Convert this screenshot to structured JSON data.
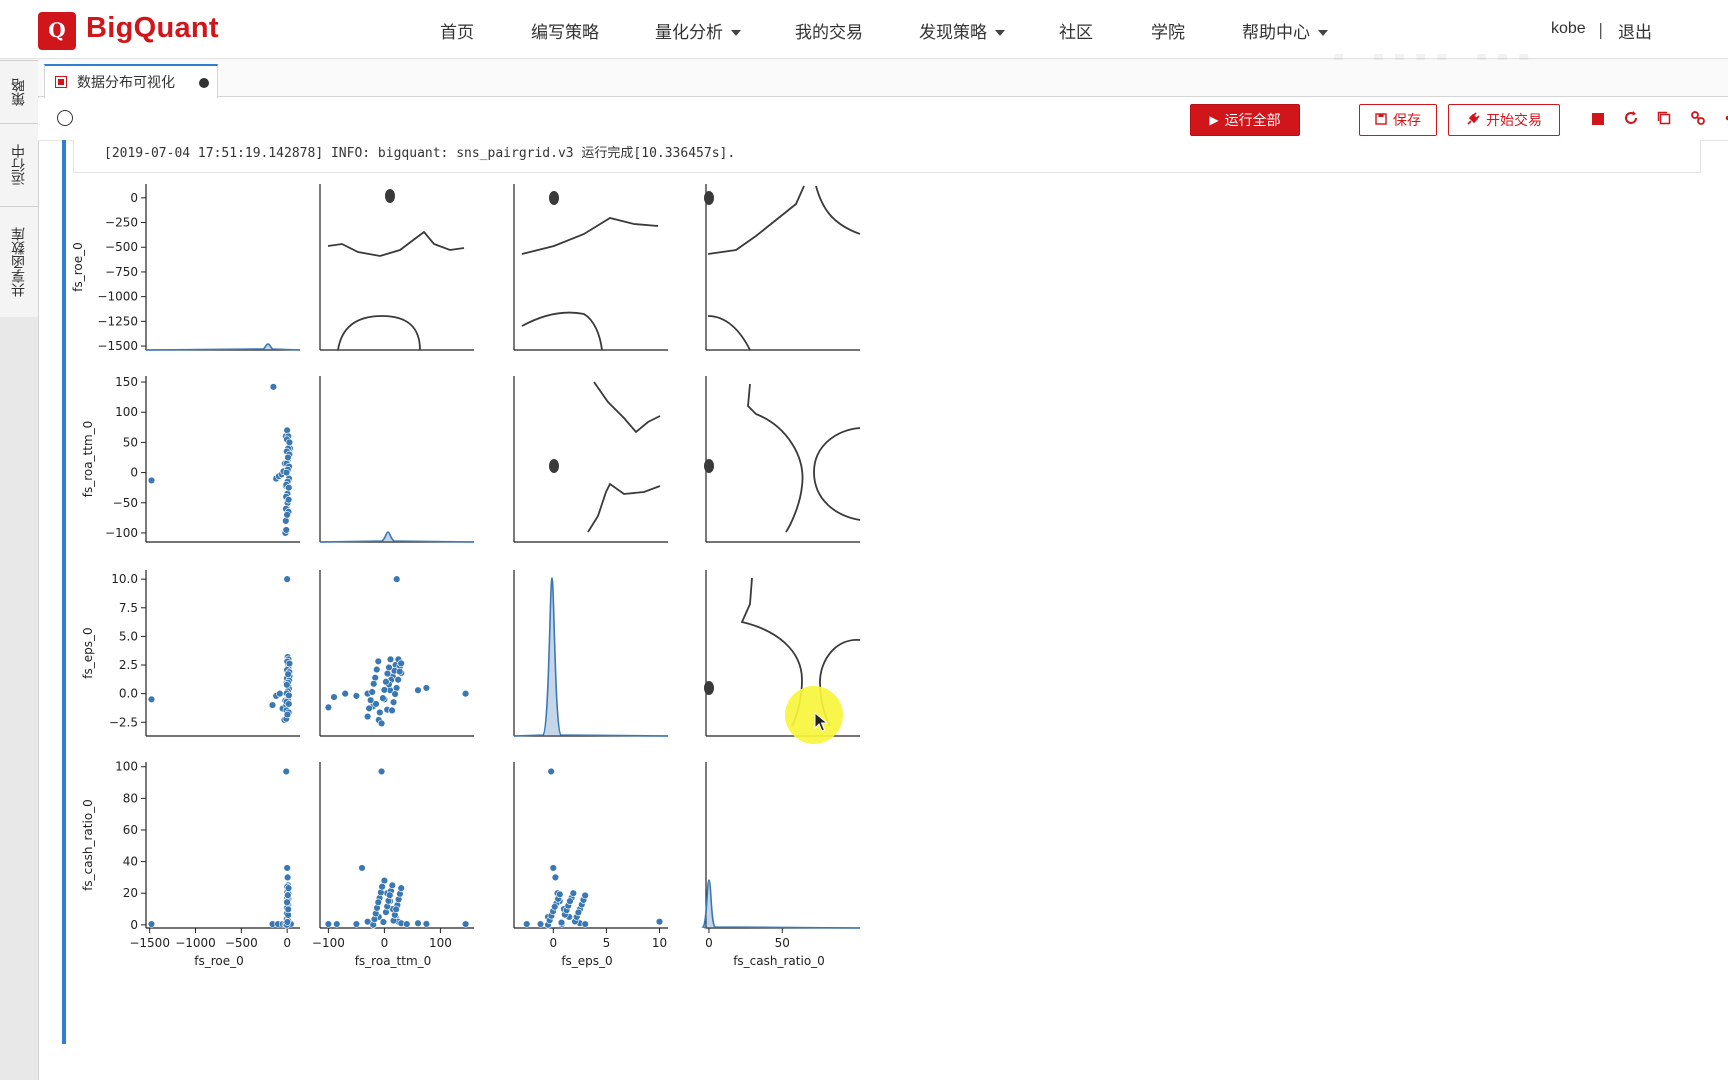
{
  "header": {
    "logo_mark": "Q",
    "logo_text": "BigQuant",
    "nav": [
      {
        "label": "首页",
        "dropdown": false
      },
      {
        "label": "编写策略",
        "dropdown": false
      },
      {
        "label": "量化分析",
        "dropdown": true
      },
      {
        "label": "我的交易",
        "dropdown": false
      },
      {
        "label": "发现策略",
        "dropdown": true
      },
      {
        "label": "社区",
        "dropdown": false
      },
      {
        "label": "学院",
        "dropdown": false
      },
      {
        "label": "帮助中心",
        "dropdown": true
      }
    ],
    "user": "kobe",
    "separator": "|",
    "logout": "退出",
    "brand_color": "#d0161b"
  },
  "sidebar": {
    "tabs": [
      "策略",
      "运行中",
      "共享函数库"
    ]
  },
  "tab": {
    "title": "数据分布可视化",
    "icon": "notebook-file-icon",
    "unsaved_indicator": "dot-icon"
  },
  "toolbar": {
    "run_all": "运行全部",
    "save": "保存",
    "start_trade": "开始交易",
    "icons": [
      "stop-icon",
      "restart-icon",
      "copy-icon",
      "link-icon",
      "share-icon"
    ]
  },
  "cell": {
    "log": "[2019-07-04 17:51:19.142878] INFO: bigquant: sns_pairgrid.v3 运行完成[10.336457s]."
  },
  "watermark": "bilibili",
  "chart_data": {
    "type": "scatter",
    "variables": [
      "fs_roe_0",
      "fs_roa_ttm_0",
      "fs_eps_0",
      "fs_cash_ratio_0"
    ],
    "diagonal": "kde",
    "upper": "kde-contour",
    "lower": "scatter",
    "point_color": "#3a78b4",
    "y_ticks": [
      [
        0,
        -250,
        -500,
        -750,
        -1000,
        -1250,
        -1500
      ],
      [
        150,
        100,
        50,
        0,
        -50,
        -100
      ],
      [
        10.0,
        7.5,
        5.0,
        2.5,
        0.0,
        -2.5
      ],
      [
        100,
        80,
        60,
        40,
        20,
        0
      ]
    ],
    "x_ticks": [
      [
        -1500,
        -1000,
        -500,
        0
      ],
      [
        -100,
        0,
        100
      ],
      [
        0,
        5,
        10
      ],
      [
        0,
        50
      ]
    ],
    "x_tick_labels": [
      [
        "−1500",
        "−1000",
        "−500",
        "0"
      ],
      [
        "−100",
        "0",
        "100"
      ],
      [
        "0",
        "5",
        "10"
      ],
      [
        "0",
        "50"
      ]
    ],
    "y_tick_labels": [
      [
        "0",
        "−250",
        "−500",
        "−750",
        "−1000",
        "−1250",
        "−1500"
      ],
      [
        "150",
        "100",
        "50",
        "0",
        "−50",
        "−100"
      ],
      [
        "10.0",
        "7.5",
        "5.0",
        "2.5",
        "0.0",
        "−2.5"
      ],
      [
        "100",
        "80",
        "60",
        "40",
        "20",
        "0"
      ]
    ],
    "limits": [
      [
        -1540,
        140
      ],
      [
        -115,
        160
      ],
      [
        -3.7,
        10.8
      ],
      [
        -2,
        103
      ]
    ],
    "sample_points": {
      "roe_roa": [
        [
          -1480,
          -13
        ],
        [
          -150,
          142
        ],
        [
          -120,
          -10
        ],
        [
          -90,
          -6
        ],
        [
          -60,
          -3
        ],
        [
          -40,
          2
        ],
        [
          -20,
          -100
        ],
        [
          -15,
          60
        ],
        [
          0,
          70
        ],
        [
          10,
          22
        ],
        [
          20,
          35
        ],
        [
          30,
          40
        ],
        [
          -10,
          -95
        ],
        [
          0,
          -60
        ],
        [
          5,
          -50
        ],
        [
          -5,
          -40
        ],
        [
          10,
          10
        ],
        [
          -25,
          15
        ],
        [
          -15,
          -22
        ]
      ],
      "roe_eps": [
        [
          -1480,
          -0.5
        ],
        [
          -160,
          -1.0
        ],
        [
          -120,
          -0.2
        ],
        [
          -80,
          0.0
        ],
        [
          -50,
          -1.3
        ],
        [
          -30,
          -2.3
        ],
        [
          -10,
          -1.0
        ],
        [
          0,
          10.0
        ],
        [
          5,
          3.2
        ],
        [
          10,
          2.5
        ],
        [
          20,
          2.0
        ],
        [
          -20,
          -0.6
        ],
        [
          -5,
          1.0
        ],
        [
          15,
          0.6
        ],
        [
          25,
          1.5
        ]
      ],
      "roe_cash": [
        [
          -1480,
          0.5
        ],
        [
          -160,
          0.5
        ],
        [
          -100,
          0.5
        ],
        [
          -50,
          0.5
        ],
        [
          -10,
          97
        ],
        [
          0,
          36
        ],
        [
          5,
          30
        ],
        [
          10,
          20
        ],
        [
          0,
          10
        ],
        [
          5,
          5
        ],
        [
          20,
          1
        ],
        [
          30,
          1
        ],
        [
          40,
          0.6
        ],
        [
          -20,
          0.5
        ]
      ],
      "roa_eps": [
        [
          -100,
          -1.2
        ],
        [
          -90,
          -0.3
        ],
        [
          -70,
          0.0
        ],
        [
          -50,
          -0.2
        ],
        [
          -30,
          0.0
        ],
        [
          -20,
          -1.1
        ],
        [
          -10,
          -2.3
        ],
        [
          -5,
          -2.6
        ],
        [
          0,
          -0.5
        ],
        [
          5,
          -1.4
        ],
        [
          10,
          0.3
        ],
        [
          15,
          1.5
        ],
        [
          20,
          2.5
        ],
        [
          25,
          3.0
        ],
        [
          18,
          2.0
        ],
        [
          12,
          1.2
        ],
        [
          8,
          0.8
        ],
        [
          22,
          10.0
        ],
        [
          60,
          0.3
        ],
        [
          75,
          0.5
        ],
        [
          145,
          0.0
        ],
        [
          28,
          2.4
        ],
        [
          -15,
          -0.9
        ],
        [
          30,
          1.8
        ]
      ],
      "roa_cash": [
        [
          -100,
          0.5
        ],
        [
          -85,
          0.5
        ],
        [
          -50,
          0.5
        ],
        [
          -40,
          36
        ],
        [
          -20,
          0.5
        ],
        [
          -5,
          97
        ],
        [
          0,
          28
        ],
        [
          5,
          20
        ],
        [
          10,
          15
        ],
        [
          15,
          10
        ],
        [
          20,
          5
        ],
        [
          25,
          2
        ],
        [
          30,
          1
        ],
        [
          40,
          0.5
        ],
        [
          60,
          1
        ],
        [
          75,
          0.6
        ],
        [
          145,
          0.5
        ],
        [
          -10,
          5
        ],
        [
          -30,
          2
        ]
      ],
      "eps_cash": [
        [
          -2.5,
          0.5
        ],
        [
          -1.2,
          0.5
        ],
        [
          -0.2,
          97
        ],
        [
          0,
          36
        ],
        [
          0.2,
          30
        ],
        [
          0.4,
          20
        ],
        [
          0.6,
          15
        ],
        [
          1.0,
          10
        ],
        [
          1.5,
          5
        ],
        [
          2.0,
          2
        ],
        [
          2.5,
          1
        ],
        [
          3.0,
          0.5
        ],
        [
          10.0,
          2.0
        ],
        [
          -0.5,
          5
        ],
        [
          0.8,
          0.5
        ]
      ]
    }
  }
}
